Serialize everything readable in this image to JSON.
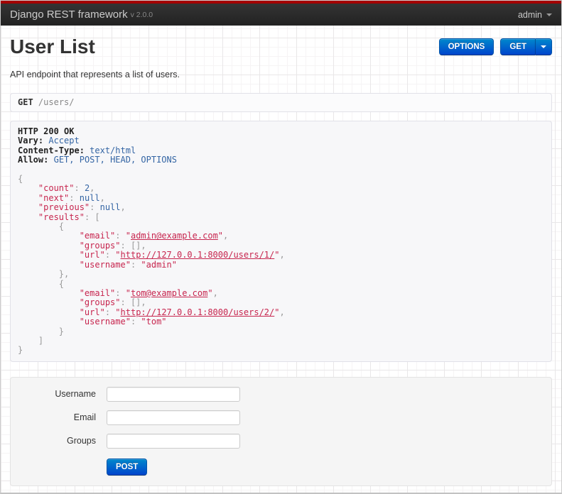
{
  "navbar": {
    "brand": "Django REST framework",
    "version": "v 2.0.0",
    "user_menu": "admin"
  },
  "header": {
    "title": "User List",
    "description": "API endpoint that represents a list of users."
  },
  "toolbar": {
    "options_label": "OPTIONS",
    "get_label": "GET"
  },
  "request_bar": {
    "method": "GET",
    "path": "/users/"
  },
  "response": {
    "status_line": "HTTP 200 OK",
    "headers": [
      {
        "name": "Vary",
        "value": "Accept"
      },
      {
        "name": "Content-Type",
        "value": "text/html"
      },
      {
        "name": "Allow",
        "value": "GET, POST, HEAD, OPTIONS"
      }
    ],
    "body": {
      "count": 2,
      "next": null,
      "previous": null,
      "results": [
        {
          "email": "admin@example.com",
          "groups": [],
          "url": "http://127.0.0.1:8000/users/1/",
          "username": "admin"
        },
        {
          "email": "tom@example.com",
          "groups": [],
          "url": "http://127.0.0.1:8000/users/2/",
          "username": "tom"
        }
      ]
    },
    "lines": [
      [
        {
          "t": "HTTP 200 OK",
          "c": "bold"
        }
      ],
      [
        {
          "t": "Vary:",
          "c": "bold"
        },
        {
          "t": " "
        },
        {
          "t": "Accept",
          "c": "val"
        }
      ],
      [
        {
          "t": "Content-Type:",
          "c": "bold"
        },
        {
          "t": " "
        },
        {
          "t": "text/html",
          "c": "val"
        }
      ],
      [
        {
          "t": "Allow:",
          "c": "bold"
        },
        {
          "t": " "
        },
        {
          "t": "GET, POST, HEAD, OPTIONS",
          "c": "val"
        }
      ],
      [],
      [
        {
          "t": "{",
          "c": "pun"
        }
      ],
      [
        {
          "t": "    "
        },
        {
          "t": "\"count\"",
          "c": "key"
        },
        {
          "t": ": ",
          "c": "pun"
        },
        {
          "t": "2",
          "c": "lit"
        },
        {
          "t": ",",
          "c": "pun"
        }
      ],
      [
        {
          "t": "    "
        },
        {
          "t": "\"next\"",
          "c": "key"
        },
        {
          "t": ": ",
          "c": "pun"
        },
        {
          "t": "null",
          "c": "lit"
        },
        {
          "t": ",",
          "c": "pun"
        }
      ],
      [
        {
          "t": "    "
        },
        {
          "t": "\"previous\"",
          "c": "key"
        },
        {
          "t": ": ",
          "c": "pun"
        },
        {
          "t": "null",
          "c": "lit"
        },
        {
          "t": ",",
          "c": "pun"
        }
      ],
      [
        {
          "t": "    "
        },
        {
          "t": "\"results\"",
          "c": "key"
        },
        {
          "t": ": ",
          "c": "pun"
        },
        {
          "t": "[",
          "c": "pun"
        }
      ],
      [
        {
          "t": "        "
        },
        {
          "t": "{",
          "c": "pun"
        }
      ],
      [
        {
          "t": "            "
        },
        {
          "t": "\"email\"",
          "c": "key"
        },
        {
          "t": ": ",
          "c": "pun"
        },
        {
          "t": "\"",
          "c": "str"
        },
        {
          "t": "admin@example.com",
          "c": "lnk"
        },
        {
          "t": "\"",
          "c": "str"
        },
        {
          "t": ",",
          "c": "pun"
        }
      ],
      [
        {
          "t": "            "
        },
        {
          "t": "\"groups\"",
          "c": "key"
        },
        {
          "t": ": ",
          "c": "pun"
        },
        {
          "t": "[]",
          "c": "pun"
        },
        {
          "t": ",",
          "c": "pun"
        }
      ],
      [
        {
          "t": "            "
        },
        {
          "t": "\"url\"",
          "c": "key"
        },
        {
          "t": ": ",
          "c": "pun"
        },
        {
          "t": "\"",
          "c": "str"
        },
        {
          "t": "http://127.0.0.1:8000/users/1/",
          "c": "lnk"
        },
        {
          "t": "\"",
          "c": "str"
        },
        {
          "t": ",",
          "c": "pun"
        }
      ],
      [
        {
          "t": "            "
        },
        {
          "t": "\"username\"",
          "c": "key"
        },
        {
          "t": ": ",
          "c": "pun"
        },
        {
          "t": "\"admin\"",
          "c": "str"
        }
      ],
      [
        {
          "t": "        "
        },
        {
          "t": "},",
          "c": "pun"
        }
      ],
      [
        {
          "t": "        "
        },
        {
          "t": "{",
          "c": "pun"
        }
      ],
      [
        {
          "t": "            "
        },
        {
          "t": "\"email\"",
          "c": "key"
        },
        {
          "t": ": ",
          "c": "pun"
        },
        {
          "t": "\"",
          "c": "str"
        },
        {
          "t": "tom@example.com",
          "c": "lnk"
        },
        {
          "t": "\"",
          "c": "str"
        },
        {
          "t": ",",
          "c": "pun"
        }
      ],
      [
        {
          "t": "            "
        },
        {
          "t": "\"groups\"",
          "c": "key"
        },
        {
          "t": ": ",
          "c": "pun"
        },
        {
          "t": "[]",
          "c": "pun"
        },
        {
          "t": ",",
          "c": "pun"
        }
      ],
      [
        {
          "t": "            "
        },
        {
          "t": "\"url\"",
          "c": "key"
        },
        {
          "t": ": ",
          "c": "pun"
        },
        {
          "t": "\"",
          "c": "str"
        },
        {
          "t": "http://127.0.0.1:8000/users/2/",
          "c": "lnk"
        },
        {
          "t": "\"",
          "c": "str"
        },
        {
          "t": ",",
          "c": "pun"
        }
      ],
      [
        {
          "t": "            "
        },
        {
          "t": "\"username\"",
          "c": "key"
        },
        {
          "t": ": ",
          "c": "pun"
        },
        {
          "t": "\"tom\"",
          "c": "str"
        }
      ],
      [
        {
          "t": "        "
        },
        {
          "t": "}",
          "c": "pun"
        }
      ],
      [
        {
          "t": "    "
        },
        {
          "t": "]",
          "c": "pun"
        }
      ],
      [
        {
          "t": "}",
          "c": "pun"
        }
      ]
    ]
  },
  "form": {
    "fields": [
      {
        "label": "Username",
        "value": "",
        "placeholder": ""
      },
      {
        "label": "Email",
        "value": "",
        "placeholder": ""
      },
      {
        "label": "Groups",
        "value": "",
        "placeholder": ""
      }
    ],
    "submit_label": "POST"
  },
  "colors": {
    "navbar_bg": "#2b2b2b",
    "navbar_accent_red": "#a30000",
    "button_blue_top": "#0088cc",
    "button_blue_bottom": "#0044cc",
    "code_key": "#c7254e",
    "code_literal": "#3465a4",
    "panel_bg": "#f7f7f9",
    "panel_border": "#e1e1e8"
  }
}
